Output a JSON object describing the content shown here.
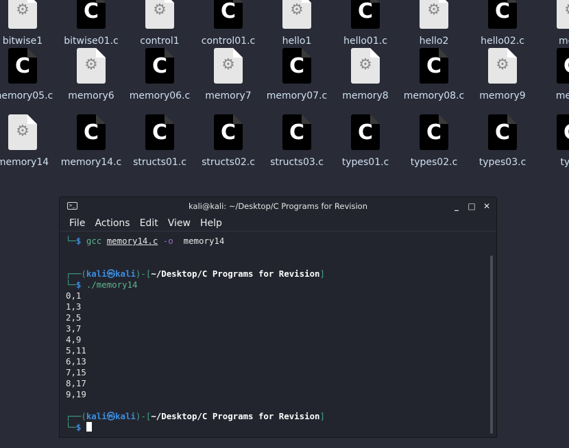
{
  "desktop": {
    "rows": [
      [
        {
          "name": "bitwise1",
          "type": "exe"
        },
        {
          "name": "bitwise01.c",
          "type": "c"
        },
        {
          "name": "control1",
          "type": "exe"
        },
        {
          "name": "control01.c",
          "type": "c"
        },
        {
          "name": "hello1",
          "type": "exe"
        },
        {
          "name": "hello01.c",
          "type": "c"
        },
        {
          "name": "hello2",
          "type": "exe"
        },
        {
          "name": "hello02.c",
          "type": "c"
        },
        {
          "name": "mem",
          "type": "exe"
        }
      ],
      [
        {
          "name": "memory05.c",
          "type": "c"
        },
        {
          "name": "memory6",
          "type": "exe"
        },
        {
          "name": "memory06.c",
          "type": "c"
        },
        {
          "name": "memory7",
          "type": "exe"
        },
        {
          "name": "memory07.c",
          "type": "c"
        },
        {
          "name": "memory8",
          "type": "exe"
        },
        {
          "name": "memory08.c",
          "type": "c"
        },
        {
          "name": "memory9",
          "type": "exe"
        },
        {
          "name": "memo",
          "type": "c"
        }
      ],
      [
        {
          "name": "memory14",
          "type": "exe"
        },
        {
          "name": "memory14.c",
          "type": "c"
        },
        {
          "name": "structs01.c",
          "type": "c"
        },
        {
          "name": "structs02.c",
          "type": "c"
        },
        {
          "name": "structs03.c",
          "type": "c"
        },
        {
          "name": "types01.c",
          "type": "c"
        },
        {
          "name": "types02.c",
          "type": "c"
        },
        {
          "name": "types03.c",
          "type": "c"
        },
        {
          "name": "type",
          "type": "c"
        }
      ]
    ]
  },
  "terminal": {
    "title": "kali@kali: ~/Desktop/C Programs for Revision",
    "menu": [
      "File",
      "Actions",
      "Edit",
      "View",
      "Help"
    ],
    "cmd1": {
      "cmd": "gcc",
      "file": "memory14.c",
      "flag": "-o",
      "out": "memory14"
    },
    "prompt": {
      "user": "kali",
      "host": "kali",
      "path": "~/Desktop/C Programs for Revision"
    },
    "cmd2": "./memory14",
    "output": [
      "0,1",
      "1,3",
      "2,5",
      "3,7",
      "4,9",
      "5,11",
      "6,13",
      "7,15",
      "8,17",
      "9,19"
    ]
  },
  "colors": {
    "desktop_bg": "#292b37",
    "terminal_bg": "#23252e",
    "prompt_blue": "#3a8de0",
    "prompt_green": "#3ea58e"
  }
}
